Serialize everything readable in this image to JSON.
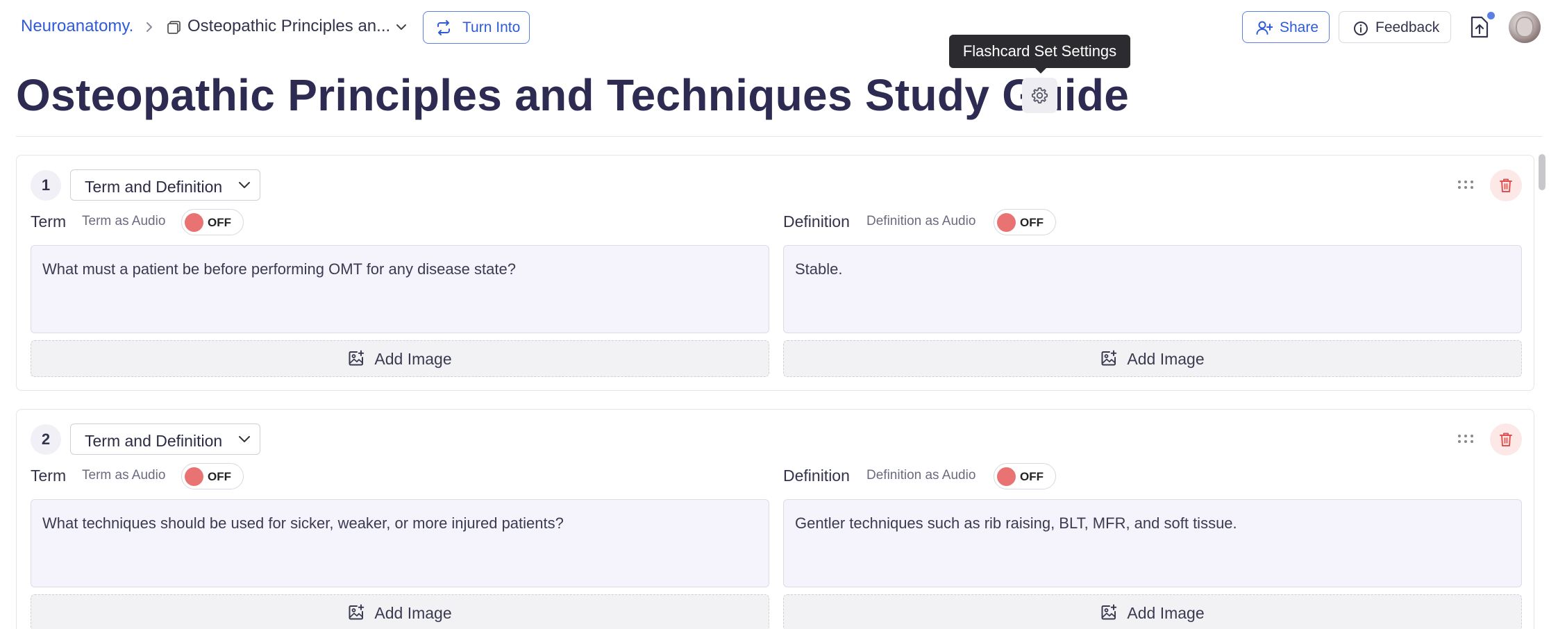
{
  "breadcrumb": {
    "root": "Neuroanatomy.",
    "document": "Osteopathic Principles an..."
  },
  "toolbar": {
    "turn_into": "Turn Into",
    "share": "Share",
    "feedback": "Feedback"
  },
  "tooltip": "Flashcard Set Settings",
  "title": "Osteopathic Principles and Techniques Study Guide",
  "cards": [
    {
      "number": "1",
      "type": "Term and Definition",
      "term_label": "Term",
      "term_audio_label": "Term as Audio",
      "term_audio_state": "OFF",
      "definition_label": "Definition",
      "definition_audio_label": "Definition as Audio",
      "definition_audio_state": "OFF",
      "term": "What must a patient be before performing OMT for any disease state?",
      "definition": "Stable.",
      "add_image_term": "Add Image",
      "add_image_definition": "Add Image"
    },
    {
      "number": "2",
      "type": "Term and Definition",
      "term_label": "Term",
      "term_audio_label": "Term as Audio",
      "term_audio_state": "OFF",
      "definition_label": "Definition",
      "definition_audio_label": "Definition as Audio",
      "definition_audio_state": "OFF",
      "term": "What techniques should be used for sicker, weaker, or more injured patients?",
      "definition": "Gentler techniques such as rib raising, BLT, MFR, and soft tissue.",
      "add_image_term": "Add Image",
      "add_image_definition": "Add Image"
    }
  ],
  "icons": {
    "breadcrumb_separator": "chevron-right-icon",
    "document": "flashcard-set-icon",
    "turn_into": "repeat-arrows-icon",
    "share": "add-user-icon",
    "feedback": "info-icon",
    "export": "export-file-icon",
    "settings": "gear-icon",
    "drag": "drag-handle-icon",
    "delete": "trash-icon",
    "add_image": "image-plus-icon"
  },
  "colors": {
    "accent": "#2f5bd9",
    "title": "#2d2b52",
    "toggle_off": "#e97373",
    "delete": "#e05252",
    "field_bg": "#f5f4fd"
  }
}
